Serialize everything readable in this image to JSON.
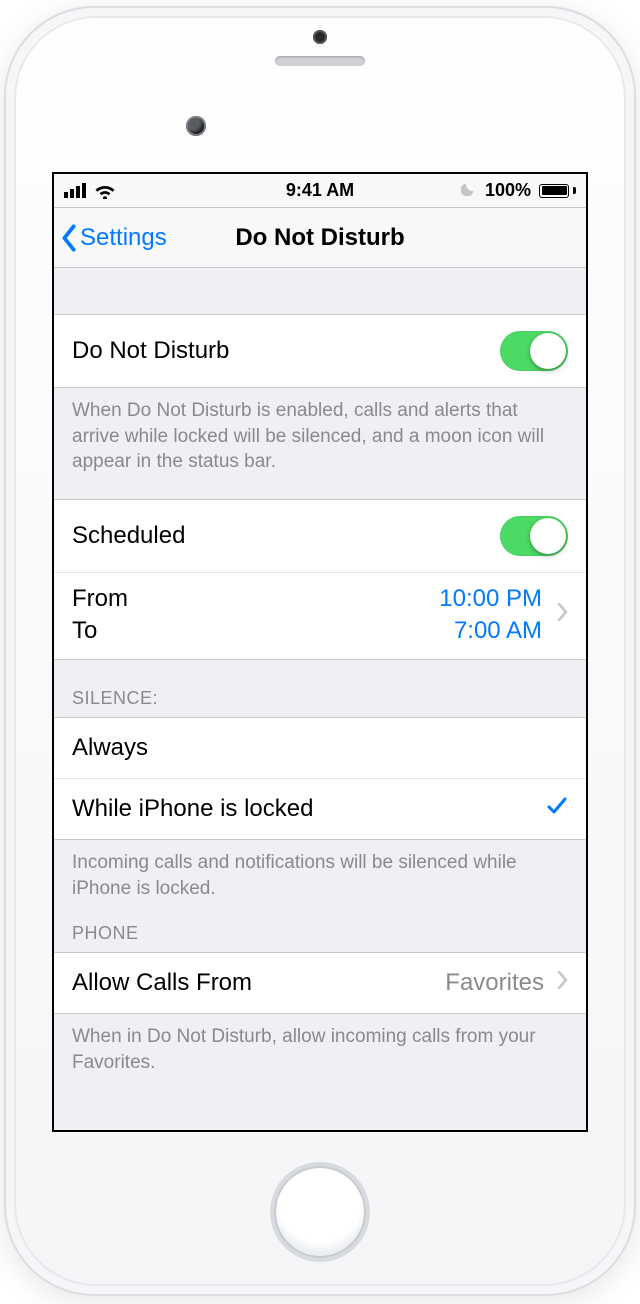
{
  "status": {
    "time": "9:41 AM",
    "battery_pct": "100%"
  },
  "nav": {
    "back": "Settings",
    "title": "Do Not Disturb"
  },
  "dnd": {
    "label": "Do Not Disturb",
    "enabled": true,
    "footer": "When Do Not Disturb is enabled, calls and alerts that arrive while locked will be silenced, and a moon icon will appear in the status bar."
  },
  "scheduled": {
    "label": "Scheduled",
    "enabled": true,
    "from_label": "From",
    "from_value": "10:00 PM",
    "to_label": "To",
    "to_value": "7:00 AM"
  },
  "silence": {
    "header": "SILENCE:",
    "options": {
      "always": "Always",
      "locked": "While iPhone is locked"
    },
    "selected": "locked",
    "footer": "Incoming calls and notifications will be silenced while iPhone is locked."
  },
  "phone": {
    "header": "PHONE",
    "allow_label": "Allow Calls From",
    "allow_value": "Favorites",
    "footer": "When in Do Not Disturb, allow incoming calls from your Favorites."
  }
}
